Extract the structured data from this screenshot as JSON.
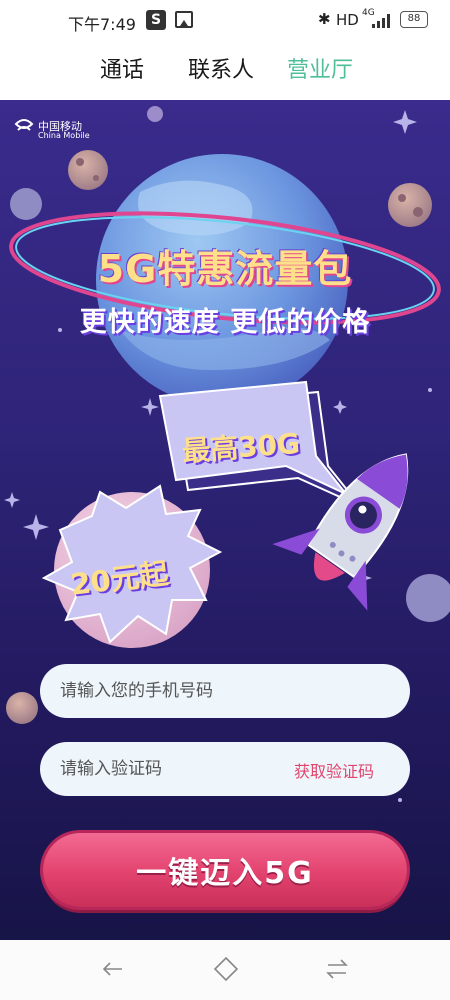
{
  "status_bar": {
    "time": "下午7:49",
    "app_icon_letter": "S",
    "bluetooth": "✱",
    "hd": "HD",
    "network": "4G",
    "battery": "88"
  },
  "tabs": [
    {
      "label": "通话",
      "active": false
    },
    {
      "label": "联系人",
      "active": false
    },
    {
      "label": "营业厅",
      "active": true
    }
  ],
  "promo": {
    "brand_cn": "中国移动",
    "brand_en": "China Mobile",
    "headline": "5G特惠流量包",
    "subline": "更快的速度 更低的价格",
    "bubble": "最高30G",
    "price": "20元起"
  },
  "form": {
    "phone_placeholder": "请输入您的手机号码",
    "code_placeholder": "请输入验证码",
    "get_code": "获取验证码",
    "submit": "一键迈入5G"
  },
  "colors": {
    "accent_tab": "#4fbf9a",
    "cta": "#e2426e",
    "background": "#2e2478",
    "link": "#e0456d"
  }
}
